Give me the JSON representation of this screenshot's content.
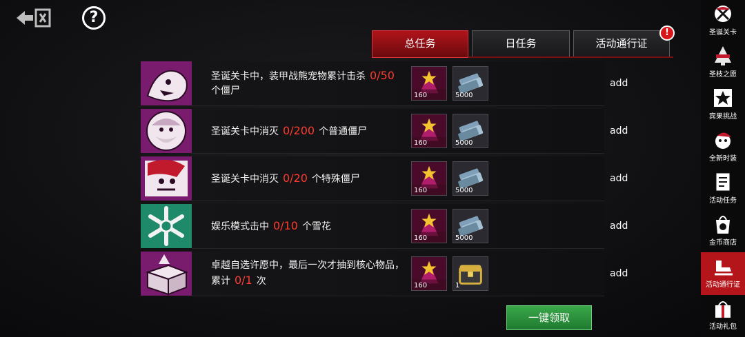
{
  "tabs": [
    {
      "label": "总任务",
      "active": true
    },
    {
      "label": "日任务",
      "active": false
    },
    {
      "label": "活动通行证",
      "active": false,
      "badge": "!"
    }
  ],
  "tasks": [
    {
      "pre": "圣诞关卡中，装甲战熊宠物累计击杀",
      "progress": "0/50",
      "post": "个僵尸",
      "rewards": [
        {
          "icon": "tree-ticket-icon",
          "qty": "160"
        },
        {
          "icon": "cash-stack-icon",
          "qty": "5000"
        }
      ],
      "action": "add",
      "thumb": "bear-icon"
    },
    {
      "pre": "圣诞关卡中消灭",
      "progress": "0/200",
      "post": "个普通僵尸",
      "rewards": [
        {
          "icon": "tree-ticket-icon",
          "qty": "160"
        },
        {
          "icon": "cash-stack-icon",
          "qty": "5000"
        }
      ],
      "action": "add",
      "thumb": "santa-icon"
    },
    {
      "pre": "圣诞关卡中消灭",
      "progress": "0/20",
      "post": "个特殊僵尸",
      "rewards": [
        {
          "icon": "tree-ticket-icon",
          "qty": "160"
        },
        {
          "icon": "cash-stack-icon",
          "qty": "5000"
        }
      ],
      "action": "add",
      "thumb": "zombie-santa-icon"
    },
    {
      "pre": "娱乐模式击中",
      "progress": "0/10",
      "post": "个雪花",
      "rewards": [
        {
          "icon": "tree-ticket-icon",
          "qty": "160"
        },
        {
          "icon": "cash-stack-icon",
          "qty": "5000"
        }
      ],
      "action": "add",
      "thumb": "snowflake-icon"
    },
    {
      "pre": "卓越自选许愿中，最后一次才抽到核心物品，累计",
      "progress": "0/1",
      "post": "次",
      "rewards": [
        {
          "icon": "tree-ticket-icon",
          "qty": "160"
        },
        {
          "icon": "gold-chest-icon",
          "qty": "1"
        }
      ],
      "action": "add",
      "thumb": "gift-box-icon"
    }
  ],
  "claim_all": "一键领取",
  "sidebar": [
    {
      "label": "圣诞关卡",
      "icon": "christmas-stage-icon"
    },
    {
      "label": "圣枝之愿",
      "icon": "christmas-tree-icon"
    },
    {
      "label": "宾果挑战",
      "icon": "bingo-star-icon"
    },
    {
      "label": "全新时装",
      "icon": "santa-hat-icon"
    },
    {
      "label": "活动任务",
      "icon": "task-notepad-icon"
    },
    {
      "label": "金币商店",
      "icon": "shopping-bag-icon"
    },
    {
      "label": "活动通行证",
      "icon": "sleigh-icon",
      "active": true
    },
    {
      "label": "活动礼包",
      "icon": "gift-pack-icon"
    }
  ],
  "colors": {
    "accent_red": "#b3151a",
    "progress_red": "#ff3b30",
    "claim_green": "#2e9a40",
    "snow_thumb": "#1f8a6a",
    "purple_thumb": "#7a1c6e"
  }
}
